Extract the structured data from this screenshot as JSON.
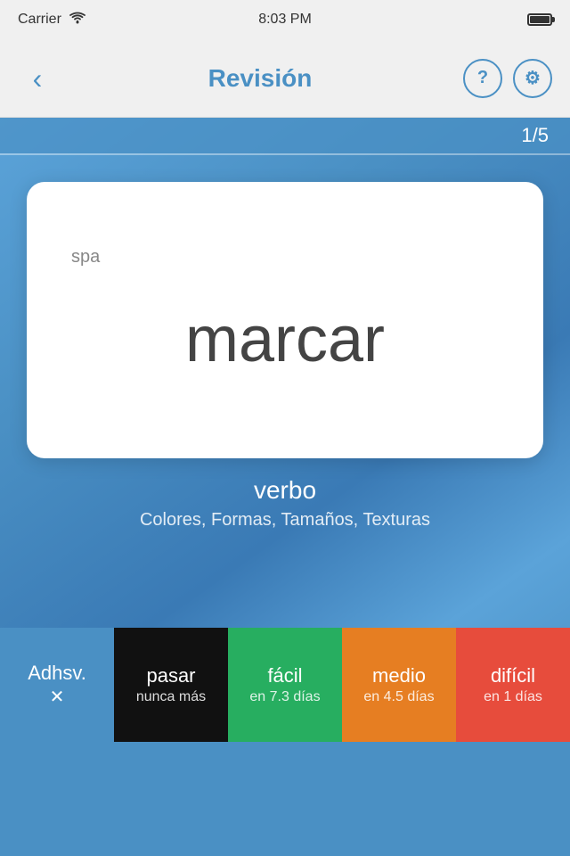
{
  "statusBar": {
    "carrier": "Carrier",
    "wifi": "wifi",
    "time": "8:03 PM",
    "battery": "full"
  },
  "navBar": {
    "backLabel": "<",
    "title": "Revisión",
    "helpLabel": "?",
    "settingsLabel": "⚙"
  },
  "progress": {
    "current": 1,
    "total": 5,
    "display": "1/5"
  },
  "card": {
    "language": "spa",
    "word": "marcar",
    "type": "verbo",
    "categories": "Colores, Formas, Tamaños, Texturas"
  },
  "actions": [
    {
      "id": "sticky",
      "label": "Adhsv.",
      "sublabel": "✕",
      "colorClass": "btn-blue"
    },
    {
      "id": "skip",
      "label": "pasar",
      "sublabel": "nunca más",
      "colorClass": "btn-black"
    },
    {
      "id": "easy",
      "label": "fácil",
      "sublabel": "en 7.3 días",
      "colorClass": "btn-green"
    },
    {
      "id": "medium",
      "label": "medio",
      "sublabel": "en 4.5 días",
      "colorClass": "btn-orange"
    },
    {
      "id": "hard",
      "label": "difícil",
      "sublabel": "en 1 días",
      "colorClass": "btn-red"
    }
  ]
}
